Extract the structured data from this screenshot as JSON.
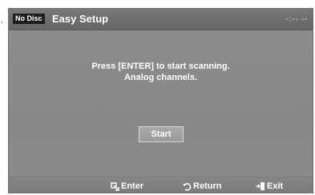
{
  "screen": {
    "side_mark": ",",
    "title_bar": {
      "badge": "No Disc",
      "title": "Easy Setup",
      "time": "-:-- --"
    },
    "message": {
      "line1": "Press [ENTER] to start scanning.",
      "line2": "Analog channels."
    },
    "start_button": {
      "label": "Start"
    },
    "footer": {
      "enter": {
        "label": "Enter",
        "icon": "enter-icon"
      },
      "return": {
        "label": "Return",
        "icon": "return-icon"
      },
      "exit": {
        "label": "Exit",
        "icon": "exit-icon"
      }
    }
  }
}
